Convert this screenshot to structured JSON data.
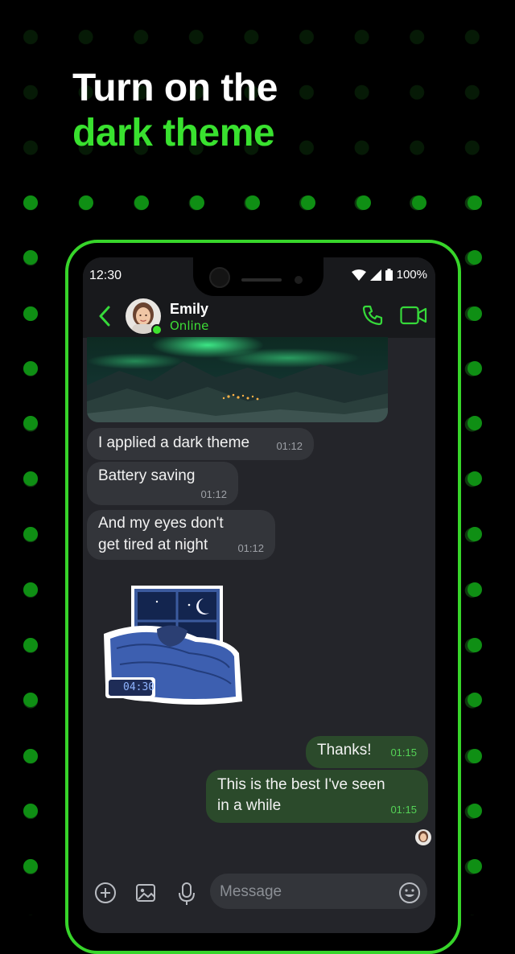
{
  "promo": {
    "line1": "Turn on the",
    "line2": "dark theme"
  },
  "status_bar": {
    "time": "12:30",
    "battery": "100%"
  },
  "chat_header": {
    "contact_name": "Emily",
    "presence": "Online"
  },
  "messages": [
    {
      "text": "I applied a dark theme",
      "time": "01:12",
      "direction": "incoming"
    },
    {
      "text": "Battery saving",
      "time": "01:12",
      "direction": "incoming"
    },
    {
      "line1": "And my eyes don't",
      "line2": "get tired at night",
      "time": "01:12",
      "direction": "incoming"
    },
    {
      "text": "Thanks!",
      "time": "01:15",
      "direction": "outgoing"
    },
    {
      "line1": "This is the best I've seen",
      "line2": "in a while",
      "time": "01:15",
      "direction": "outgoing"
    }
  ],
  "sticker": {
    "clock": "04:30"
  },
  "composer": {
    "placeholder": "Message"
  },
  "colors": {
    "accent": "#39e12f",
    "background": "#000000",
    "chat_bg": "#24252a",
    "outgoing_bubble": "#2b4a2b"
  },
  "icons": [
    "back-arrow-icon",
    "phone-call-icon",
    "video-call-icon",
    "add-icon",
    "gallery-icon",
    "microphone-icon",
    "emoji-icon",
    "wifi-icon",
    "signal-icon",
    "battery-icon"
  ]
}
